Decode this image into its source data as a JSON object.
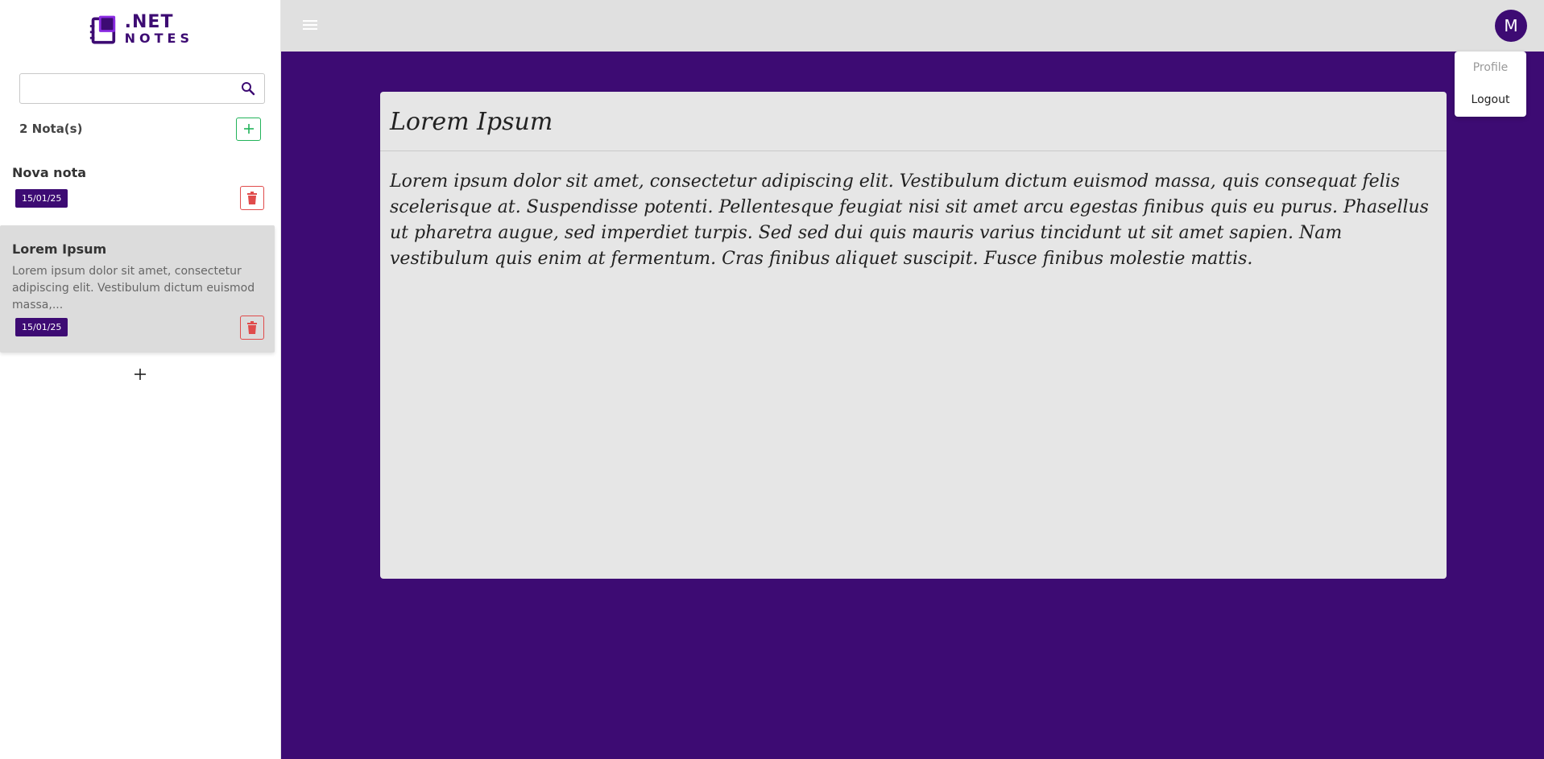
{
  "app": {
    "logo_line1": ".NET",
    "logo_line2": "NOTES",
    "brand_color": "#3d0b73"
  },
  "sidebar": {
    "search": {
      "value": "",
      "placeholder": ""
    },
    "count_label": "2 Nota(s)",
    "notes": [
      {
        "title": "Nova nota",
        "preview": "",
        "date": "15/01/25",
        "selected": false
      },
      {
        "title": "Lorem Ipsum",
        "preview": "Lorem ipsum dolor sit amet, consectetur adipiscing elit. Vestibulum dictum euismod massa,...",
        "date": "15/01/25",
        "selected": true
      }
    ]
  },
  "header": {
    "avatar_initial": "M"
  },
  "user_menu": {
    "items": [
      "Profile",
      "Logout"
    ]
  },
  "editor": {
    "title": "Lorem Ipsum",
    "body": " Lorem ipsum dolor sit amet, consectetur adipiscing elit. Vestibulum dictum euismod massa, quis consequat felis scelerisque at. Suspendisse potenti. Pellentesque feugiat nisi sit amet arcu egestas finibus quis eu purus. Phasellus ut pharetra augue, sed imperdiet turpis. Sed sed dui quis mauris varius tincidunt ut sit amet sapien. Nam vestibulum quis enim at fermentum. Cras finibus aliquet suscipit. Fusce finibus molestie mattis."
  },
  "icons": {
    "search": "search-icon",
    "add": "plus-icon",
    "delete": "trash-icon",
    "menu": "hamburger-menu-icon"
  }
}
